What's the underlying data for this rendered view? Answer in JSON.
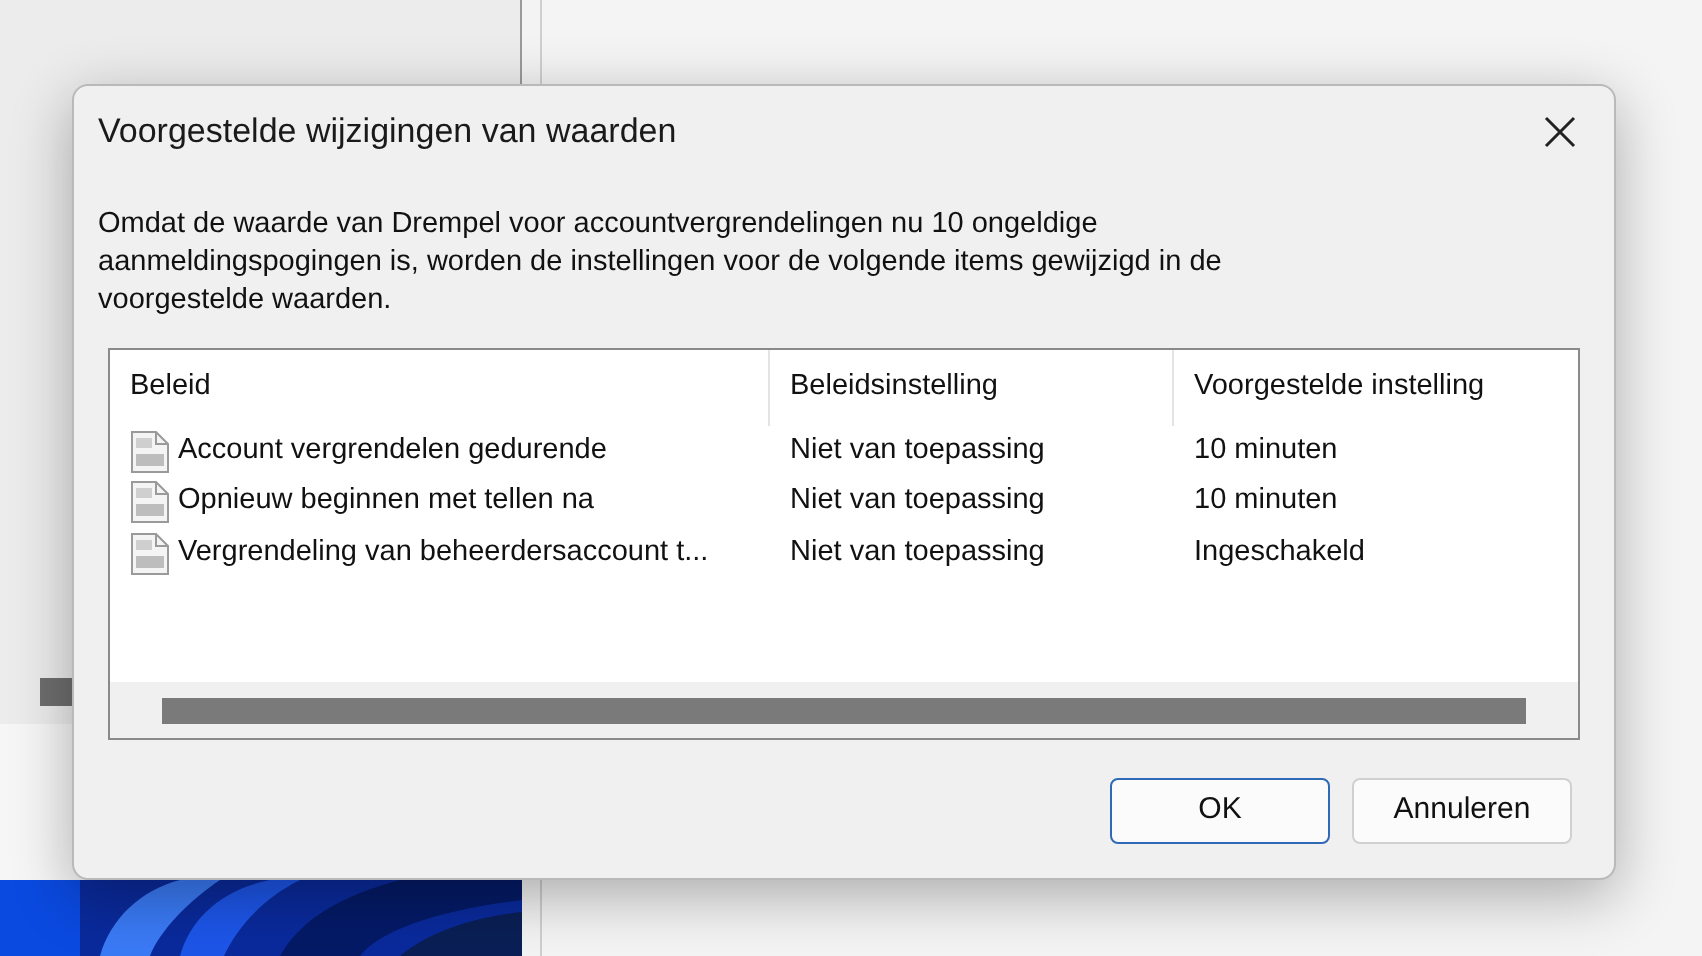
{
  "dialog": {
    "title": "Voorgestelde wijzigingen van waarden",
    "message": "Omdat de waarde van Drempel voor accountvergrendelingen nu 10 ongeldige aanmeldingspogingen is, worden de instellingen voor de volgende items gewijzigd in de voorgestelde waarden.",
    "table": {
      "columns": [
        "Beleid",
        "Beleidsinstelling",
        "Voorgestelde instelling"
      ],
      "rows": [
        [
          "Account vergrendelen gedurende",
          "Niet van toepassing",
          "10 minuten"
        ],
        [
          "Opnieuw beginnen met tellen na",
          "Niet van toepassing",
          "10 minuten"
        ],
        [
          "Vergrendeling van beheerdersaccount t...",
          "Niet van toepassing",
          "Ingeschakeld"
        ]
      ]
    },
    "buttons": [
      {
        "label": "OK",
        "default": true
      },
      {
        "label": "Annuleren",
        "default": false
      }
    ]
  }
}
